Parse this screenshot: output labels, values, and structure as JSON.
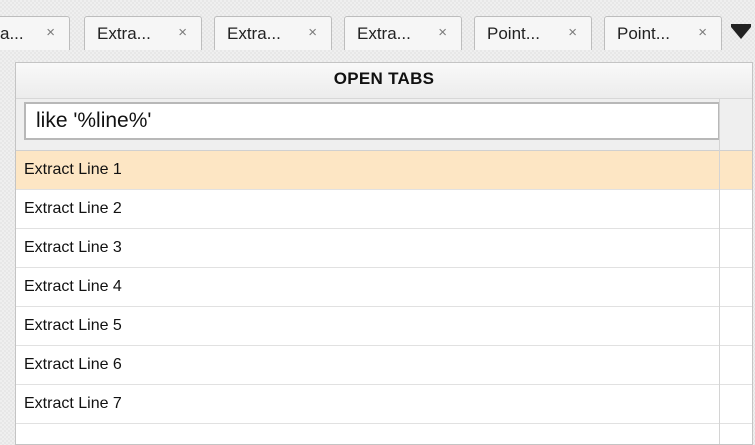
{
  "tabs": [
    {
      "label": "a...",
      "close": "×"
    },
    {
      "label": "Extra...",
      "close": "×"
    },
    {
      "label": "Extra...",
      "close": "×"
    },
    {
      "label": "Extra...",
      "close": "×"
    },
    {
      "label": "Point...",
      "close": "×"
    },
    {
      "label": "Point...",
      "close": "×"
    }
  ],
  "overflow_icon": "chevron-down-icon",
  "panel": {
    "title": "OPEN TABS",
    "search_value": "like '%line%'"
  },
  "items": [
    {
      "label": "Extract Line 1",
      "selected": true
    },
    {
      "label": "Extract Line 2"
    },
    {
      "label": "Extract Line 3"
    },
    {
      "label": "Extract Line 4"
    },
    {
      "label": "Extract Line 5"
    },
    {
      "label": "Extract Line 6"
    },
    {
      "label": "Extract Line 7"
    }
  ],
  "colors": {
    "selected_row": "#fde6c4",
    "panel_bg": "#ffffff"
  }
}
